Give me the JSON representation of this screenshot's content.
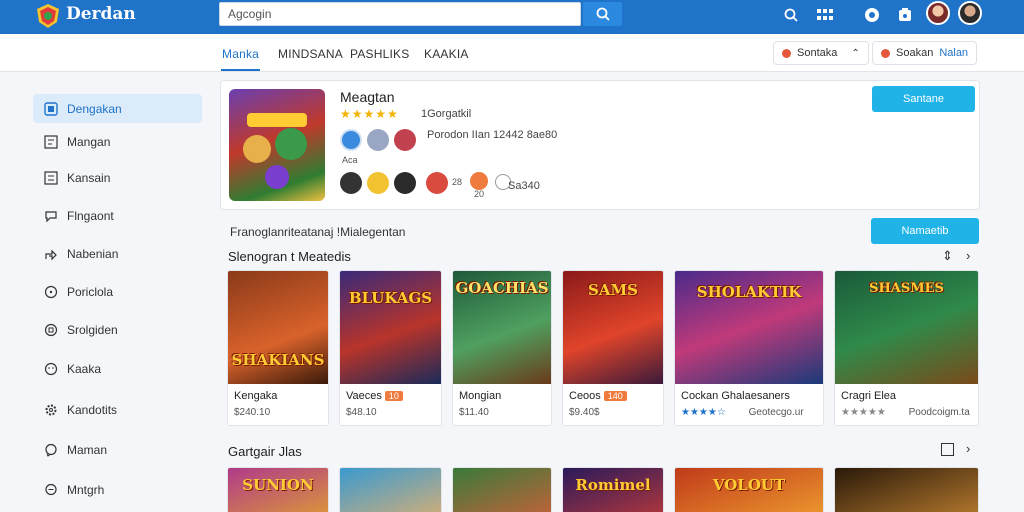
{
  "app": {
    "name": "Derdan"
  },
  "search": {
    "placeholder": "Agcogin"
  },
  "tabs": [
    {
      "label": "Manka",
      "active": true
    },
    {
      "label": "MINDSANA",
      "active": false
    },
    {
      "label": "PASHLIKS",
      "active": false
    },
    {
      "label": "KAAKIA",
      "active": false
    }
  ],
  "pills": {
    "left": "Sontaka",
    "right_a": "Soakan",
    "right_b": "Nalan"
  },
  "sidebar": {
    "items": [
      {
        "label": "Dengakan",
        "icon": "home-icon",
        "active": true
      },
      {
        "label": "Mangan",
        "icon": "grid-icon",
        "active": false
      },
      {
        "label": "Kansain",
        "icon": "list-icon",
        "active": false
      },
      {
        "label": "Flngaont",
        "icon": "chat-icon",
        "active": false
      },
      {
        "label": "Nabenian",
        "icon": "share-icon",
        "active": false
      },
      {
        "label": "Poriclola",
        "icon": "clock-icon",
        "active": false
      },
      {
        "label": "Srolgiden",
        "icon": "badge-icon",
        "active": false
      },
      {
        "label": "Kaaka",
        "icon": "smile-icon",
        "active": false
      },
      {
        "label": "Kandotits",
        "icon": "gear-icon",
        "active": false
      },
      {
        "label": "Maman",
        "icon": "chat-icon",
        "active": false
      },
      {
        "label": "Mntgrh",
        "icon": "chat-bubble-icon",
        "active": false
      }
    ]
  },
  "featured": {
    "title": "Meagtan",
    "stars": "★★★★★",
    "rating_label": "1Gorgatkil",
    "meta1": "Porodon IIan 12442 8ae80",
    "meta2": "Sa340",
    "small_a": "Aca",
    "small_b": "28",
    "small_c": "20",
    "button": "Santane"
  },
  "subheader": "Franoglanriteatanaj !Mialegentan",
  "subheader_button": "Namaetib",
  "section1": {
    "title": "Slenogran t Meatedis"
  },
  "cards": [
    {
      "art": "SHAKIANS",
      "name": "Kengaka",
      "sub": "$240.10",
      "badge": "",
      "stars": ""
    },
    {
      "art": "BLUKAGS",
      "name": "Vaeces",
      "sub": "$48.10",
      "badge": "10",
      "stars": ""
    },
    {
      "art": "GOACHIAS",
      "name": "Mongian",
      "sub": "$11.40",
      "badge": "",
      "stars": ""
    },
    {
      "art": "SAMS",
      "name": "Ceoos",
      "sub": "$9.40$",
      "badge": "140",
      "stars": ""
    },
    {
      "art": "SHOLAKTIK",
      "name": "Cockan Ghalaesaners",
      "sub": "Geotecgo.ur",
      "badge": "",
      "stars": "★★★★☆"
    },
    {
      "art": "SHASMES",
      "name": "Cragri Elea",
      "sub": "Poodcoigm.ta",
      "badge": "",
      "stars": "★★★★★"
    }
  ],
  "section2": {
    "title": "Gartgair Jlas"
  },
  "cards2": [
    {
      "art": "SUNION"
    },
    {
      "art": ""
    },
    {
      "art": ""
    },
    {
      "art": "Romimel"
    },
    {
      "art": "VOLOUT"
    },
    {
      "art": ""
    }
  ],
  "colors": {
    "primary": "#1f73c9",
    "accent": "#1fb3e8",
    "badge": "#f07b3f"
  }
}
